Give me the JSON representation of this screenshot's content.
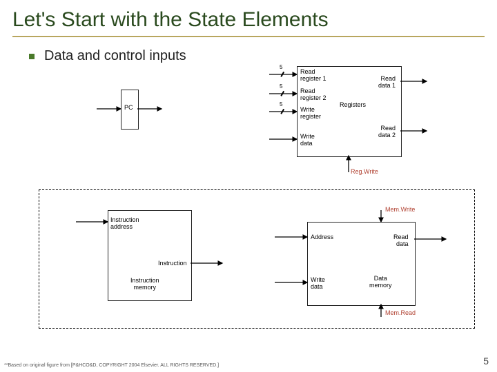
{
  "title": "Let's Start with the State Elements",
  "bullet": "Data and control inputs",
  "pc": {
    "label": "PC"
  },
  "regfile": {
    "readreg1": "Read\nregister 1",
    "readreg2": "Read\nregister 2",
    "writereg": "Write\nregister",
    "writedata": "Write\ndata",
    "readdata1": "Read\ndata 1",
    "readdata2": "Read\ndata 2",
    "center": "Registers",
    "regwrite": "Reg.Write",
    "bus1": "5",
    "bus2": "5",
    "bus3": "5"
  },
  "imem": {
    "instaddr": "Instruction\naddress",
    "inst": "Instruction",
    "caption": "Instruction\nmemory"
  },
  "dmem": {
    "addr": "Address",
    "writedata": "Write\ndata",
    "readdata": "Read\ndata",
    "caption": "Data\nmemory",
    "memwrite": "Mem.Write",
    "memread": "Mem.Read"
  },
  "footnote": "**Based on original figure from [P&HCO&D, COPYRIGHT 2004 Elsevier. ALL RIGHTS RESERVED.]",
  "pagenum": "5"
}
